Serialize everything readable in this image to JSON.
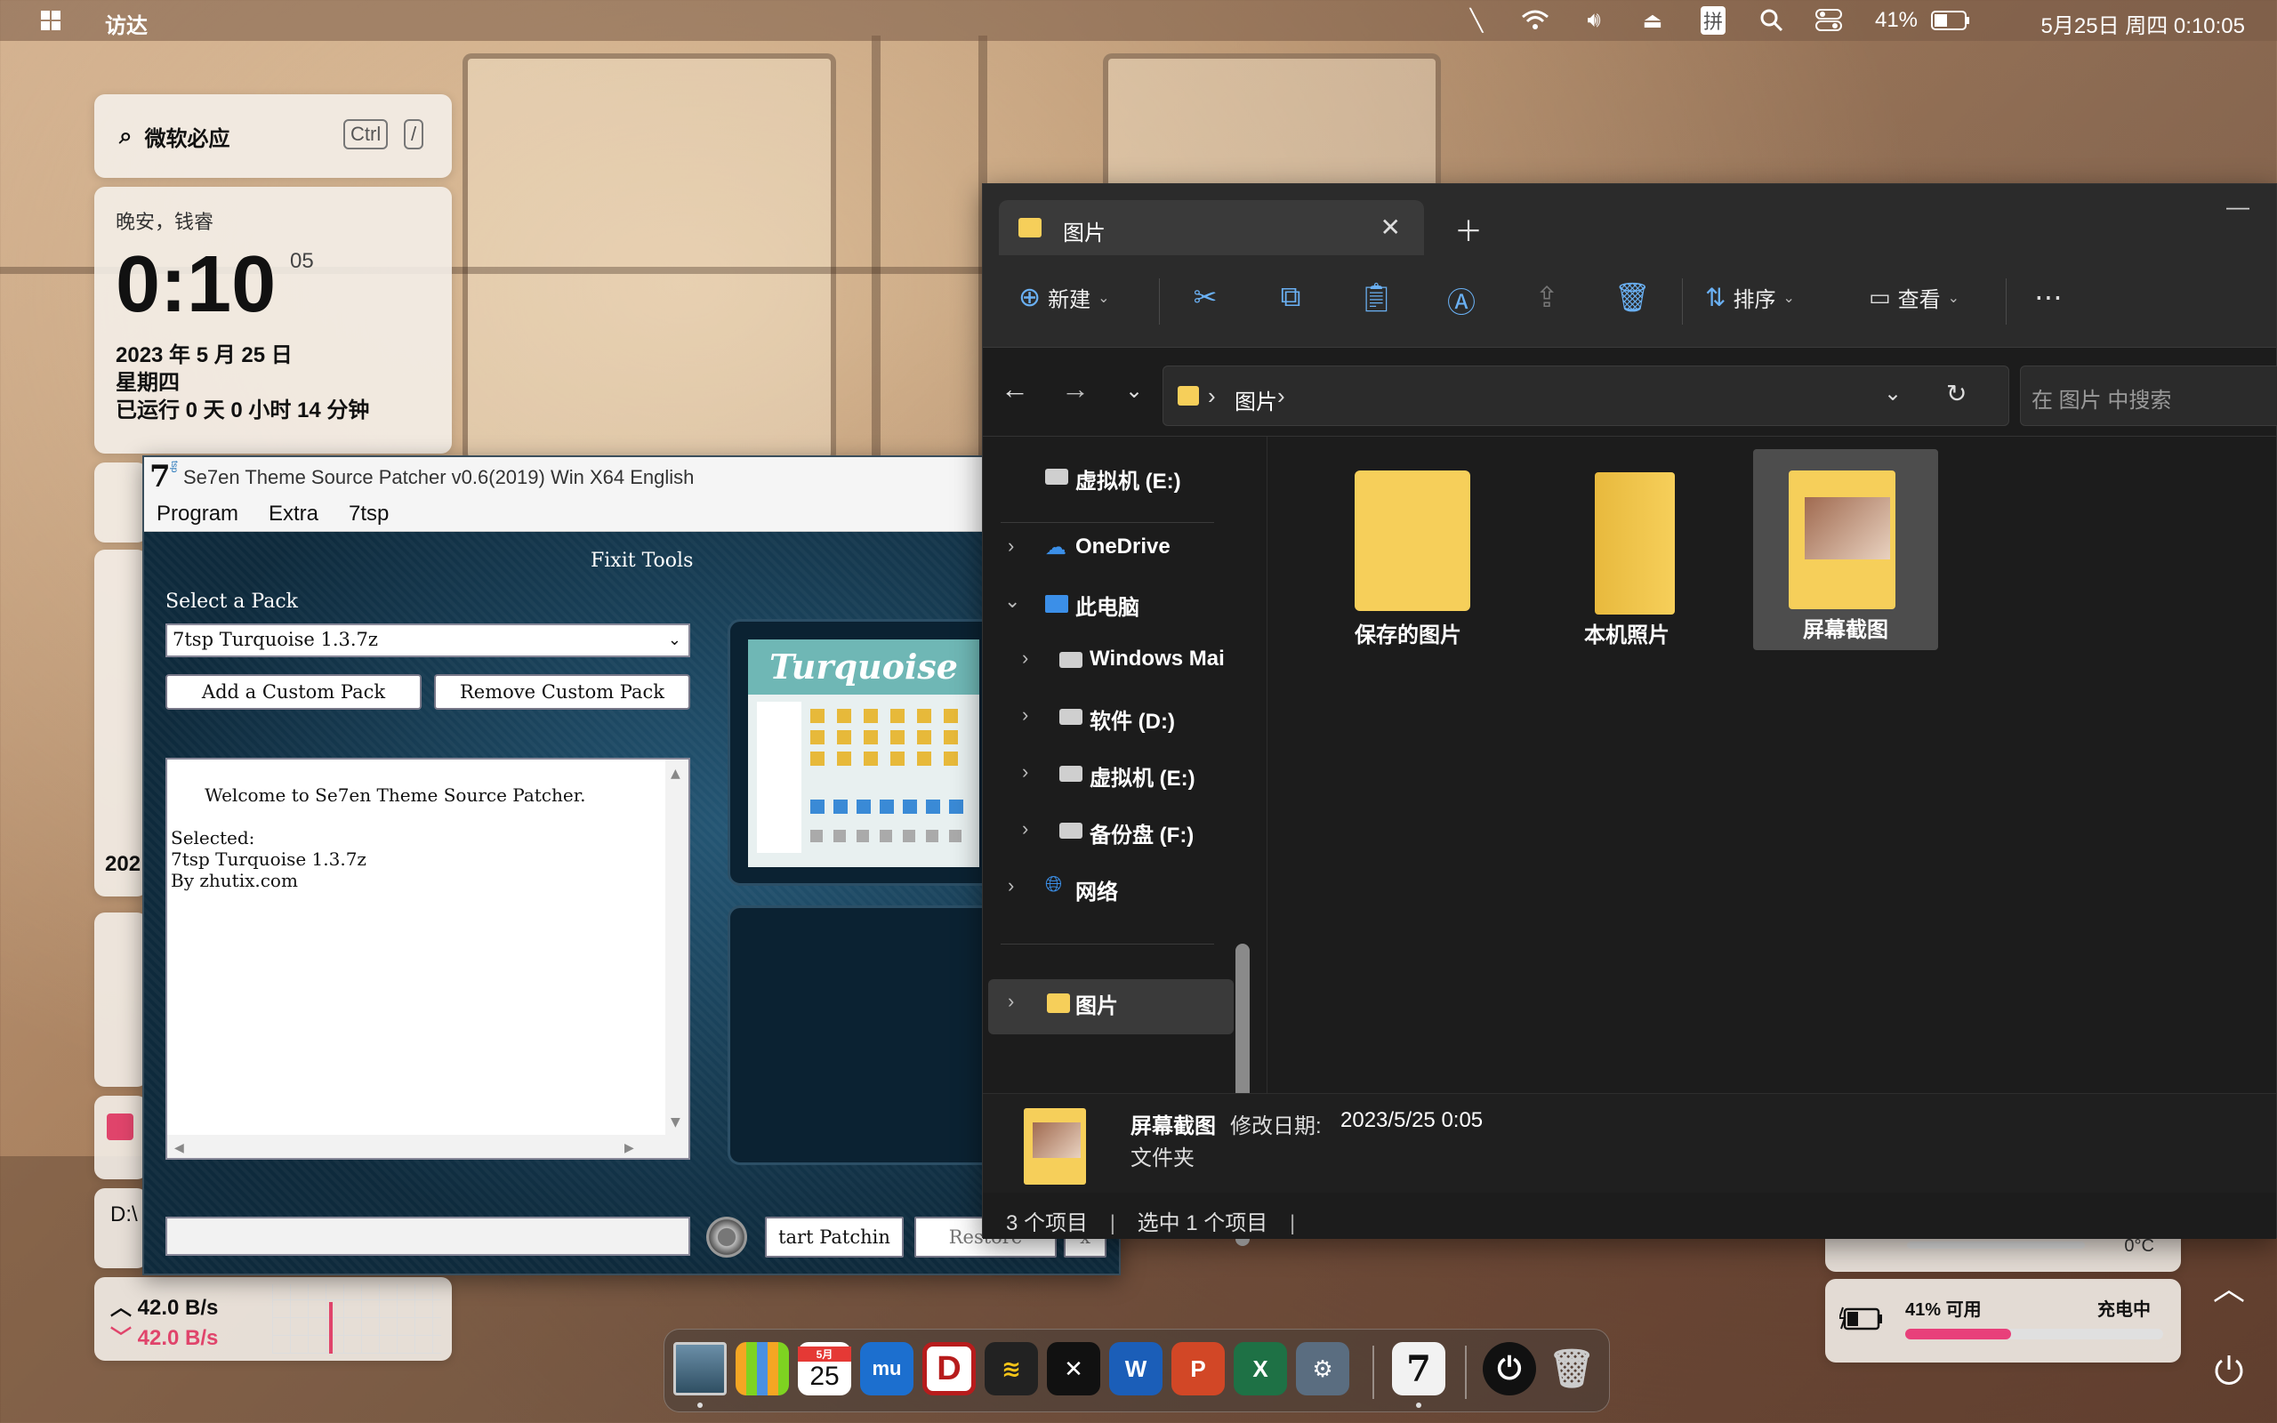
{
  "menubar": {
    "app_name": "访达",
    "battery_percent": "41%",
    "datetime": "5月25日 周四 0:10:05",
    "ime": "拼"
  },
  "widgets": {
    "search": {
      "placeholder": "微软必应",
      "shortcut_ctrl": "Ctrl",
      "shortcut_slash": "/"
    },
    "clock": {
      "greeting": "晚安，钱睿",
      "time": "0:10",
      "seconds": "05",
      "date": "2023 年 5 月 25 日",
      "weekday": "星期四",
      "uptime": "已运行 0 天 0 小时 14 分钟"
    },
    "calendar_year_partial": "202",
    "network": {
      "upload": "42.0 B/s",
      "download": "42.0 B/s"
    },
    "disk_partial": "D:\\",
    "battery": {
      "label": "41% 可用",
      "status": "充电中",
      "level": 0.41
    },
    "weather": {
      "temp": "0°C"
    }
  },
  "patcher": {
    "title": "Se7en Theme Source Patcher v0.6(2019) Win X64 English",
    "logo": "7",
    "logo_sub": "tsp",
    "menu": [
      "Program",
      "Extra",
      "7tsp"
    ],
    "section_title": "Fixit Tools",
    "select_label": "Select a Pack",
    "selected_pack": "7tsp Turquoise 1.3.7z",
    "add_button": "Add a Custom Pack",
    "remove_button": "Remove Custom Pack",
    "log_text": "Welcome to Se7en Theme Source Patcher.\n\nSelected:\n7tsp Turquoise 1.3.7z\nBy zhutix.com",
    "preview_title": "Turquoise",
    "start_button": "tart Patchin",
    "restore_button": "Restore",
    "extra_button": "x"
  },
  "explorer": {
    "tab_title": "图片",
    "toolbar": {
      "new": "新建",
      "sort": "排序",
      "view": "查看"
    },
    "breadcrumb": "图片",
    "search_placeholder": "在 图片 中搜索",
    "nav": [
      {
        "label": "虚拟机 (E:)"
      },
      {
        "label": "OneDrive"
      },
      {
        "label": "此电脑"
      },
      {
        "label": "Windows Mai"
      },
      {
        "label": "软件 (D:)"
      },
      {
        "label": "虚拟机 (E:)"
      },
      {
        "label": "备份盘 (F:)"
      },
      {
        "label": "网络"
      },
      {
        "label": "图片"
      }
    ],
    "files": [
      {
        "name": "保存的图片"
      },
      {
        "name": "本机照片"
      },
      {
        "name": "屏幕截图"
      }
    ],
    "details": {
      "name": "屏幕截图",
      "modified_label": "修改日期:",
      "modified_value": "2023/5/25 0:05",
      "type": "文件夹"
    },
    "status": {
      "count": "3 个项目",
      "selected": "选中 1 个项目"
    }
  },
  "dock": {
    "calendar_month": "5月",
    "calendar_day": "25",
    "apps": [
      "desktop",
      "launchpad",
      "calendar",
      "mu",
      "dictionary",
      "wasp",
      "capcut",
      "word",
      "powerpoint",
      "excel",
      "settings",
      "7tsp",
      "power",
      "trash"
    ]
  }
}
